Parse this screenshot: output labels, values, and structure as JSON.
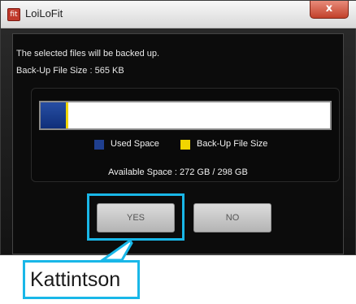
{
  "window": {
    "title": "LoiLoFit",
    "app_icon_glyph": "fit",
    "close_glyph": "x"
  },
  "message": {
    "line1": "The selected files will be backed up.",
    "line2": "Back-Up File Size : 565 KB"
  },
  "storage": {
    "used_fraction": 0.086,
    "backup_fraction": 2e-06,
    "used_color": "#1f3f8f",
    "backup_color": "#f1d600",
    "legend": {
      "used_label": "Used Space",
      "backup_label": "Back-Up File Size"
    },
    "available_text": "Available Space : 272 GB / 298 GB"
  },
  "buttons": {
    "yes_label": "YES",
    "no_label": "NO"
  },
  "callout": {
    "label": "Kattintson",
    "color": "#19b7e8"
  }
}
